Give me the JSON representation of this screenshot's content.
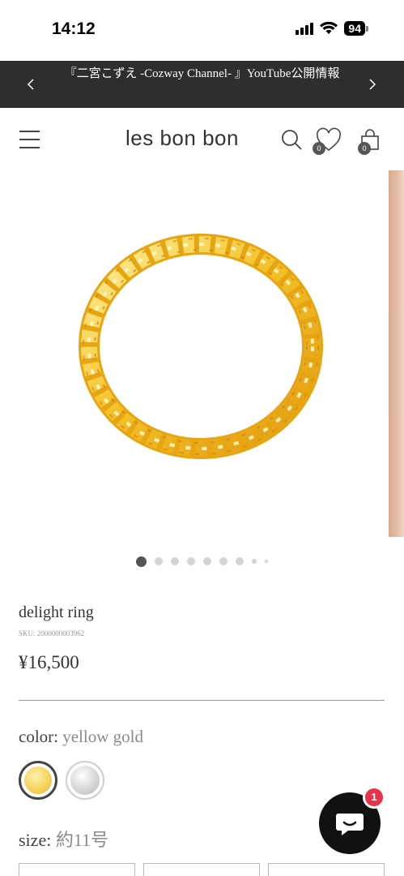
{
  "status_bar": {
    "time": "14:12",
    "battery_level": "94",
    "icons": [
      "cellular-signal-icon",
      "wifi-icon",
      "battery-icon"
    ]
  },
  "announcement": {
    "text": "『二宮こずえ -Cozway Channel- 』YouTube公開情報",
    "prev_icon": "chevron-left-icon",
    "next_icon": "chevron-right-icon"
  },
  "header": {
    "logo": "les bon bon",
    "icons": [
      "menu-icon",
      "search-icon",
      "heart-icon",
      "shopping-bag-icon"
    ],
    "wishlist_count": "0",
    "cart_count": "0"
  },
  "gallery": {
    "image": "gold rope ring",
    "total_slides": 9,
    "active_slide": 1
  },
  "product": {
    "title": "delight ring",
    "sku": "SKU: 2000000003962",
    "price": "¥16,500"
  },
  "options": {
    "color": {
      "label": "color:",
      "selected": "yellow gold",
      "swatches": [
        {
          "name": "yellow gold",
          "color": "#f2cc55",
          "selected": true
        },
        {
          "name": "silver",
          "color": "#cfcfcf",
          "selected": false
        }
      ]
    },
    "size": {
      "label": "size:",
      "selected": "約11号"
    }
  },
  "chat": {
    "icon": "chat-bubble-icon",
    "badge_count": "1",
    "background": "#111111",
    "badge_color": "#e8334a"
  },
  "colors": {
    "announcement_bg": "#2e2e2e",
    "text": "#333333",
    "muted": "#8a8a8a"
  }
}
